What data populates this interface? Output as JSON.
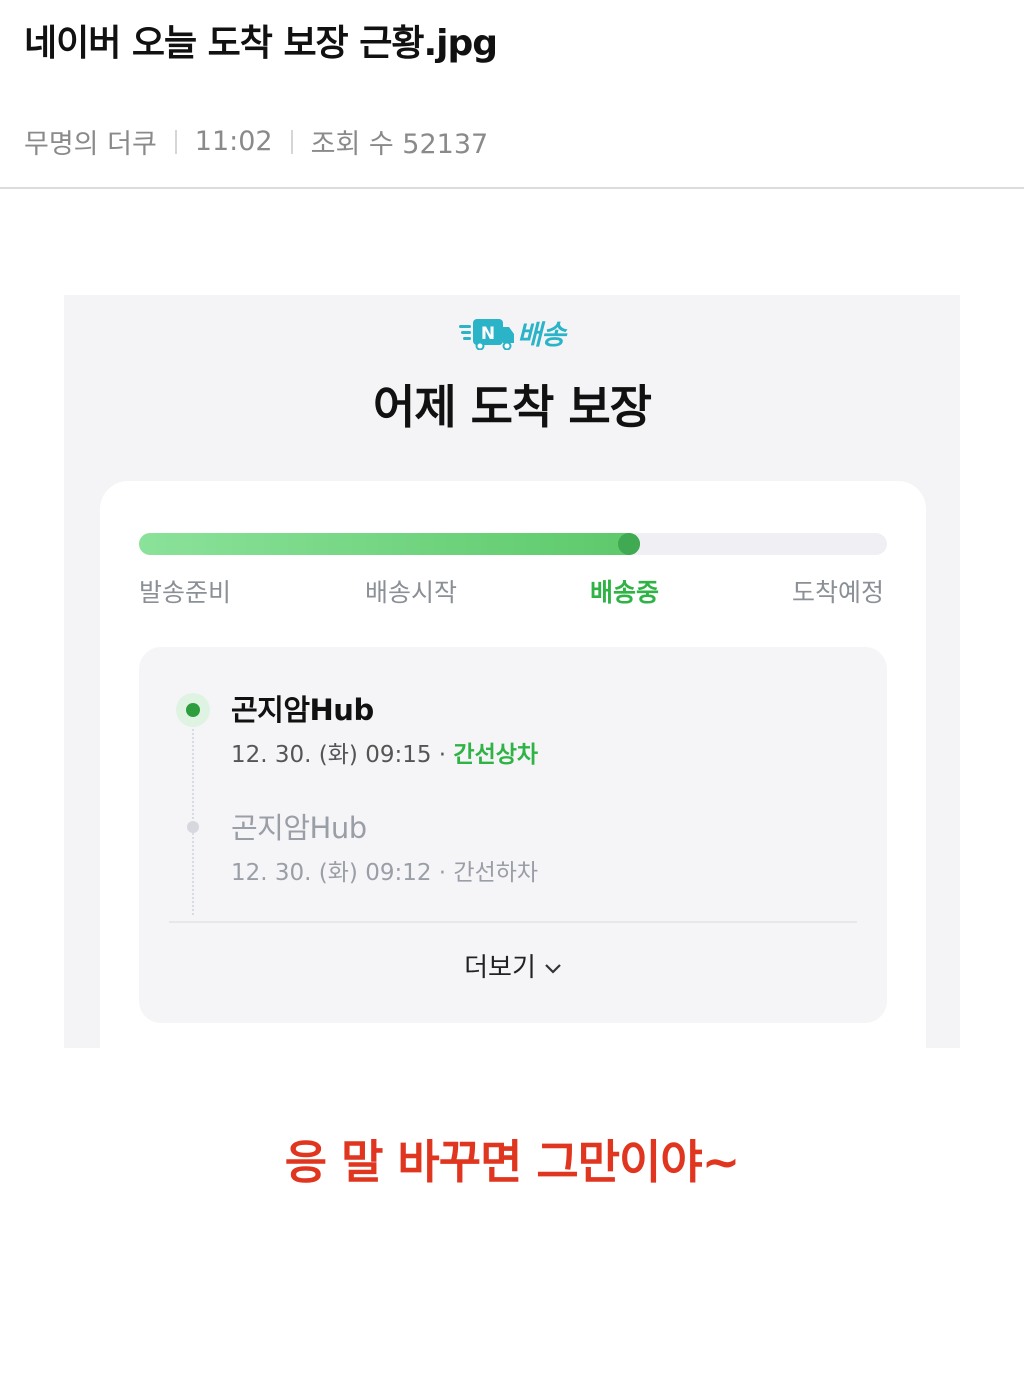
{
  "post": {
    "title": "네이버 오늘 도착 보장 근황.jpg",
    "author": "무명의 더쿠",
    "time": "11:02",
    "views_label": "조회 수 52137"
  },
  "screenshot": {
    "brand_text": "배송",
    "brand_badge": "N",
    "title": "어제 도착 보장",
    "progress": {
      "fraction": 0.67,
      "steps": [
        "발송준비",
        "배송시작",
        "배송중",
        "도착예정"
      ],
      "active_index": 2,
      "fill_colors": [
        "#8be29a",
        "#5cc96a"
      ],
      "active_color": "#2fb344"
    },
    "events": [
      {
        "location": "곤지암Hub",
        "datetime": "12. 30. (화) 09:15",
        "separator": " · ",
        "status": "간선상차"
      },
      {
        "location": "곤지암Hub",
        "datetime": "12. 30. (화) 09:12",
        "separator": " · ",
        "status": "간선하차"
      }
    ],
    "more_label": "더보기"
  },
  "caption": {
    "text": "응 말 바꾸면 그만이야~",
    "color": "#e0351f"
  },
  "icons": {
    "brand": "delivery-truck-icon",
    "more": "chevron-down-icon"
  }
}
